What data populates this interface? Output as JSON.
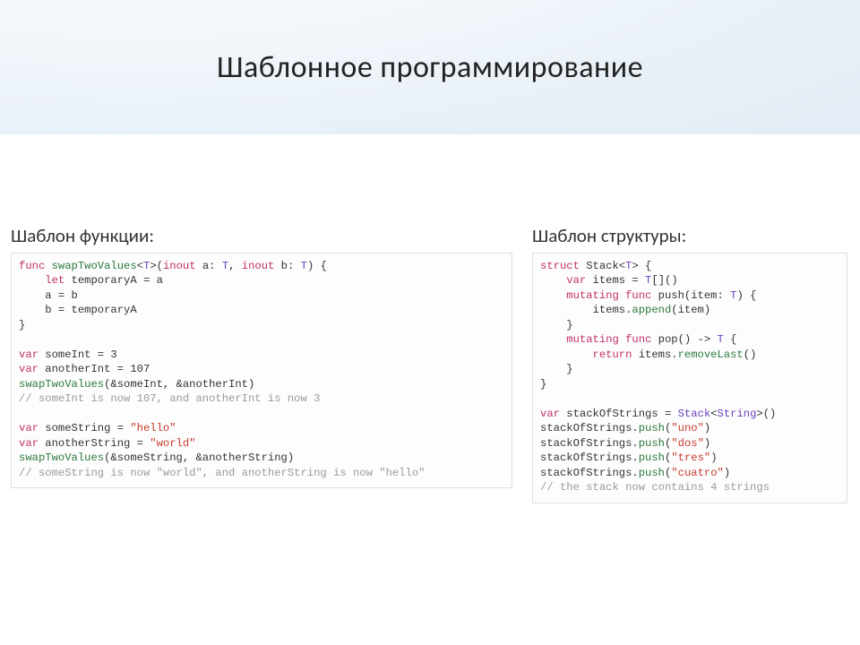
{
  "title": "Шаблонное программирование",
  "left_heading": "Шаблон функции:",
  "right_heading": "Шаблон структуры:",
  "code_left": {
    "l1a": "func",
    "l1b": "swapTwoValues",
    "l1c": "<",
    "l1d": "T",
    "l1e": ">(",
    "l1f": "inout",
    "l1g": " a: ",
    "l1h": "T",
    "l1i": ", ",
    "l1j": "inout",
    "l1k": " b: ",
    "l1l": "T",
    "l1m": ") {",
    "l2a": "let",
    "l2b": " temporaryA = a",
    "l3": "a = b",
    "l4": "b = temporaryA",
    "l5": "}",
    "l6a": "var",
    "l6b": " someInt = 3",
    "l7a": "var",
    "l7b": " anotherInt = 107",
    "l8a": "swapTwoValues",
    "l8b": "(&someInt, &anotherInt)",
    "l9": "// someInt is now 107, and anotherInt is now 3",
    "l10a": "var",
    "l10b": " someString = ",
    "l10c": "\"hello\"",
    "l11a": "var",
    "l11b": " anotherString = ",
    "l11c": "\"world\"",
    "l12a": "swapTwoValues",
    "l12b": "(&someString, &anotherString)",
    "l13": "// someString is now \"world\", and anotherString is now \"hello\""
  },
  "code_right": {
    "l1a": "struct",
    "l1b": " Stack<",
    "l1c": "T",
    "l1d": "> {",
    "l2a": "var",
    "l2b": " items = ",
    "l2c": "T",
    "l2d": "[]()",
    "l3a": "mutating func",
    "l3b": " push(item: ",
    "l3c": "T",
    "l3d": ") {",
    "l4a": "items.",
    "l4b": "append",
    "l4c": "(item)",
    "l5": "}",
    "l6a": "mutating func",
    "l6b": " pop() -> ",
    "l6c": "T",
    "l6d": " {",
    "l7a": "return",
    "l7b": " items.",
    "l7c": "removeLast",
    "l7d": "()",
    "l8": "}",
    "l9": "}",
    "l10a": "var",
    "l10b": " stackOfStrings = ",
    "l10c": "Stack",
    "l10d": "<",
    "l10e": "String",
    "l10f": ">()",
    "l11a": "stackOfStrings.",
    "l11b": "push",
    "l11c": "(",
    "l11d": "\"uno\"",
    "l11e": ")",
    "l12a": "stackOfStrings.",
    "l12b": "push",
    "l12c": "(",
    "l12d": "\"dos\"",
    "l12e": ")",
    "l13a": "stackOfStrings.",
    "l13b": "push",
    "l13c": "(",
    "l13d": "\"tres\"",
    "l13e": ")",
    "l14a": "stackOfStrings.",
    "l14b": "push",
    "l14c": "(",
    "l14d": "\"cuatro\"",
    "l14e": ")",
    "l15": "// the stack now contains 4 strings"
  }
}
